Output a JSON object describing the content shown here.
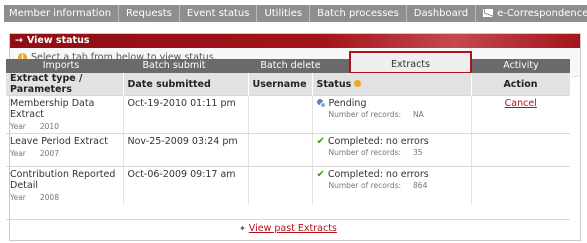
{
  "topnav": {
    "items": [
      "Member information",
      "Requests",
      "Event status",
      "Utilities",
      "Batch processes",
      "Dashboard",
      "e-Correspondence"
    ]
  },
  "panel": {
    "title": "View status",
    "instruction": "Select a tab from below to view status."
  },
  "tabs": [
    {
      "label": "Imports",
      "active": false
    },
    {
      "label": "Batch submit",
      "active": false
    },
    {
      "label": "Batch delete",
      "active": false
    },
    {
      "label": "Extracts",
      "active": true
    },
    {
      "label": "Activity",
      "active": false
    }
  ],
  "table": {
    "headers": [
      "Extract type / Parameters",
      "Date submitted",
      "Username",
      "Status",
      "Action"
    ],
    "rows": [
      {
        "type": "Membership Data Extract",
        "param_label": "Year",
        "param_value": "2010",
        "date": "Oct-19-2010 01:11 pm",
        "username": "",
        "status": "Pending",
        "status_kind": "pending",
        "records_label": "Number of records:",
        "records_value": "NA",
        "action": "Cancel"
      },
      {
        "type": "Leave Period Extract",
        "param_label": "Year",
        "param_value": "2007",
        "date": "Nov-25-2009 03:24 pm",
        "username": "",
        "status": "Completed: no errors",
        "status_kind": "completed",
        "records_label": "Number of records:",
        "records_value": "35",
        "action": ""
      },
      {
        "type": "Contribution Reported Detail",
        "param_label": "Year",
        "param_value": "2008",
        "date": "Oct-06-2009 09:17 am",
        "username": "",
        "status": "Completed: no errors",
        "status_kind": "completed",
        "records_label": "Number of records:",
        "records_value": "864",
        "action": ""
      }
    ]
  },
  "footer_link": "View past Extracts",
  "colors": {
    "header": "#a3141a",
    "nav": "#8e8e8e",
    "tabbar": "#6a6a6a",
    "completed": "#3c9a18",
    "link": "#b0121a"
  }
}
